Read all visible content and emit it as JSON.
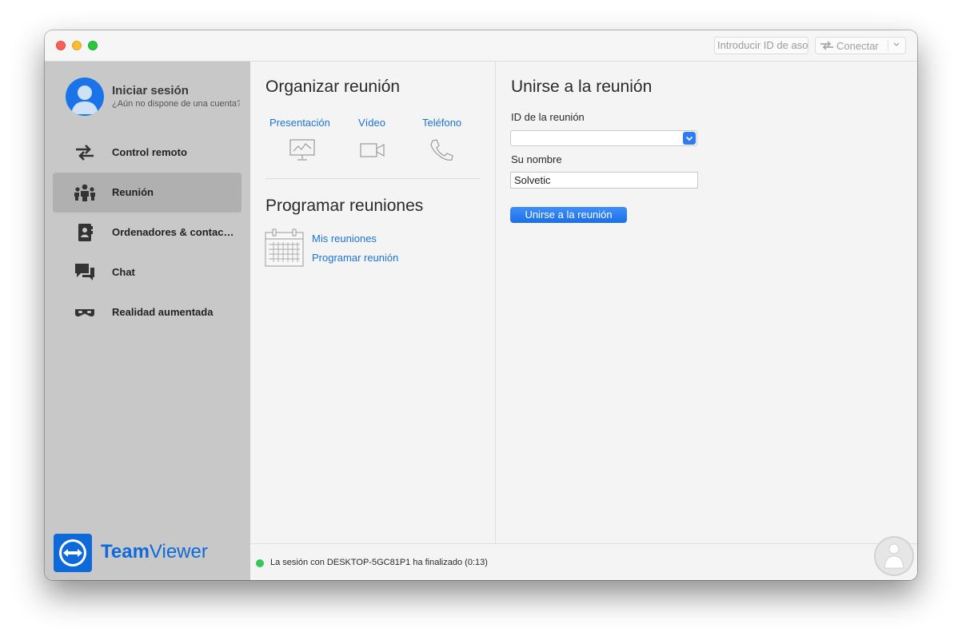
{
  "titlebar": {
    "partner_id_placeholder": "Introducir ID de asociado",
    "connect_label": "Conectar"
  },
  "sidebar": {
    "signin_title": "Iniciar sesión",
    "signin_subtitle": "¿Aún no dispone de una cuenta?",
    "items": [
      {
        "label": "Control remoto",
        "icon": "arrows-swap-icon",
        "active": false
      },
      {
        "label": "Reunión",
        "icon": "meeting-people-icon",
        "active": true
      },
      {
        "label": "Ordenadores & contactos",
        "icon": "contacts-book-icon",
        "active": false
      },
      {
        "label": "Chat",
        "icon": "chat-bubbles-icon",
        "active": false
      },
      {
        "label": "Realidad aumentada",
        "icon": "ar-glasses-icon",
        "active": false
      }
    ],
    "brand_bold": "Team",
    "brand_light": "Viewer"
  },
  "organize": {
    "title": "Organizar reunión",
    "modes": [
      {
        "label": "Presentación",
        "icon": "presentation-icon"
      },
      {
        "label": "Vídeo",
        "icon": "video-camera-icon"
      },
      {
        "label": "Teléfono",
        "icon": "phone-icon"
      }
    ]
  },
  "schedule": {
    "title": "Programar reuniones",
    "links": [
      "Mis reuniones",
      "Programar reunión"
    ]
  },
  "join": {
    "title": "Unirse a la reunión",
    "id_label": "ID de la reunión",
    "id_value": "",
    "name_label": "Su nombre",
    "name_value": "Solvetic",
    "button_label": "Unirse a la reunión"
  },
  "status": {
    "text": "La sesión con DESKTOP-5GC81P1 ha finalizado (0:13)",
    "color": "#34c759"
  },
  "colors": {
    "accent": "#1a73d9",
    "sidebar_bg": "#c8c8c8",
    "brand": "#0e6ad8"
  }
}
